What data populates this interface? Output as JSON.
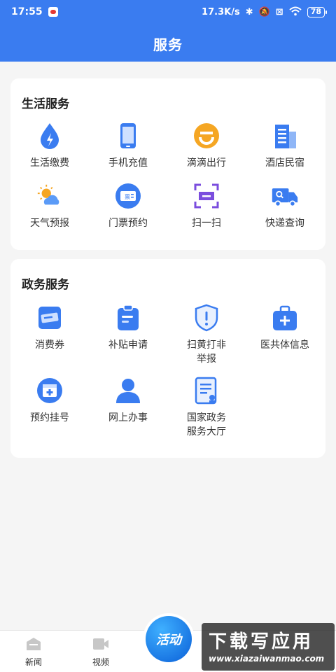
{
  "status_bar": {
    "time": "17:55",
    "speed": "17.3K/s",
    "battery": "78"
  },
  "header": {
    "title": "服务"
  },
  "life_services": {
    "title": "生活服务",
    "items": [
      {
        "label": "生活缴费",
        "icon": "water-drop-icon"
      },
      {
        "label": "手机充值",
        "icon": "phone-icon"
      },
      {
        "label": "滴滴出行",
        "icon": "didi-icon"
      },
      {
        "label": "酒店民宿",
        "icon": "hotel-building-icon"
      },
      {
        "label": "天气预报",
        "icon": "weather-icon"
      },
      {
        "label": "门票预约",
        "icon": "ticket-icon"
      },
      {
        "label": "扫一扫",
        "icon": "scan-icon"
      },
      {
        "label": "快递查询",
        "icon": "delivery-truck-icon"
      }
    ]
  },
  "gov_services": {
    "title": "政务服务",
    "items": [
      {
        "label": "消费券",
        "icon": "coupon-icon"
      },
      {
        "label": "补贴申请",
        "icon": "clipboard-icon"
      },
      {
        "label": "扫黄打非",
        "label2": "举报",
        "icon": "shield-alert-icon"
      },
      {
        "label": "医共体信息",
        "icon": "medical-kit-icon"
      },
      {
        "label": "预约挂号",
        "icon": "calendar-plus-icon"
      },
      {
        "label": "网上办事",
        "icon": "person-icon"
      },
      {
        "label": "国家政务",
        "label2": "服务大厅",
        "icon": "document-icon"
      }
    ]
  },
  "tabbar": {
    "items": [
      {
        "label": "新闻",
        "icon": "news-icon"
      },
      {
        "label": "视频",
        "icon": "video-icon"
      }
    ],
    "activity_label": "活动"
  },
  "watermark": {
    "title": "下载写应用",
    "url": "www.xiazaiwanmao.com"
  },
  "colors": {
    "primary": "#3a7cf0",
    "accent_orange": "#f5a623",
    "accent_purple": "#7b4dde"
  }
}
